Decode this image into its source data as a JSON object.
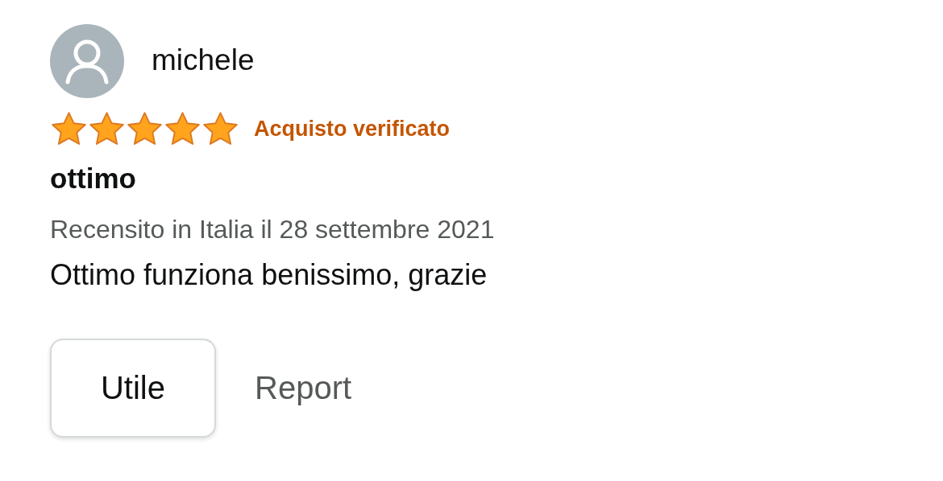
{
  "review": {
    "author": "michele",
    "stars": 5,
    "badge": "Acquisto verificato",
    "title": "ottimo",
    "date": "Recensito in Italia il 28 settembre 2021",
    "body": "Ottimo funziona benissimo, grazie"
  },
  "actions": {
    "helpful": "Utile",
    "report": "Report"
  }
}
